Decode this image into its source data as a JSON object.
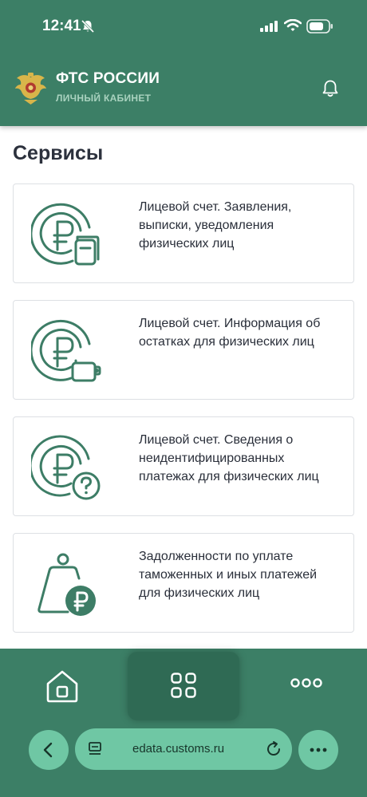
{
  "status_bar": {
    "time": "12:41"
  },
  "header": {
    "title": "ФТС РОССИИ",
    "subtitle": "ЛИЧНЫЙ КАБИНЕТ"
  },
  "section_title": "Сервисы",
  "cards": [
    {
      "text": "Лицевой счет. Заявления, выписки, уведомления физических лиц",
      "icon": "ruble-coin-document-icon"
    },
    {
      "text": "Лицевой счет. Информация об остатках для физических лиц",
      "icon": "ruble-coin-wallet-icon"
    },
    {
      "text": "Лицевой счет. Сведения о неидентифицированных платежах для физических лиц",
      "icon": "ruble-coin-question-icon"
    },
    {
      "text": "Задолженности по уплате таможенных и иных платежей для физических лиц",
      "icon": "ruble-weight-icon"
    }
  ],
  "bottom_nav": {
    "items": [
      "home-icon",
      "services-grid-icon",
      "more-dots-icon"
    ],
    "active": "services-grid-icon"
  },
  "browser": {
    "url": "edata.customs.ru"
  },
  "colors": {
    "brand_green": "#3c7f66",
    "icon_green": "#3d7d66",
    "browser_pill": "#6fc7a4"
  }
}
